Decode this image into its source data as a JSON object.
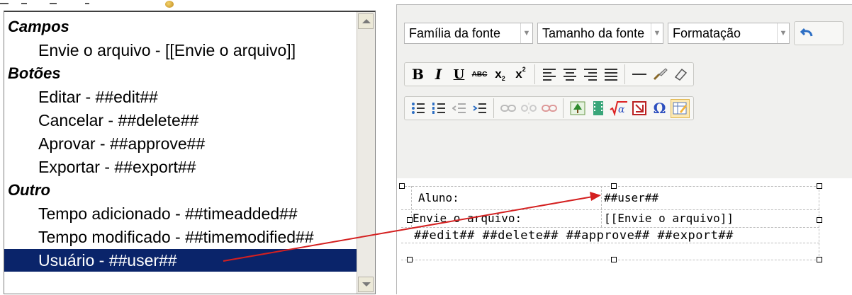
{
  "fields": {
    "groups": [
      {
        "label": "Campos",
        "items": [
          "Envie o arquivo - [[Envie o arquivo]]"
        ]
      },
      {
        "label": "Botões",
        "items": [
          "Editar - ##edit##",
          "Cancelar - ##delete##",
          "Aprovar - ##approve##",
          "Exportar - ##export##"
        ]
      },
      {
        "label": "Outro",
        "items": [
          "Tempo adicionado - ##timeadded##",
          "Tempo modificado - ##timemodified##",
          "Usuário - ##user##"
        ]
      }
    ],
    "selected": "Usuário - ##user##"
  },
  "editor": {
    "font_family": "Família da fonte",
    "font_size": "Tamanho da fonte",
    "format": "Formatação",
    "table": {
      "r1c1": "Aluno:",
      "r1c2": "##user##",
      "r2c1": "Envie o arquivo:",
      "r2c2": "[[Envie o arquivo]]",
      "r3": "##edit## ##delete## ##approve## ##export##"
    }
  },
  "colors": {
    "selection": "#0a246a",
    "toolbar": "#f0f0ee",
    "arrow": "#d42020"
  }
}
